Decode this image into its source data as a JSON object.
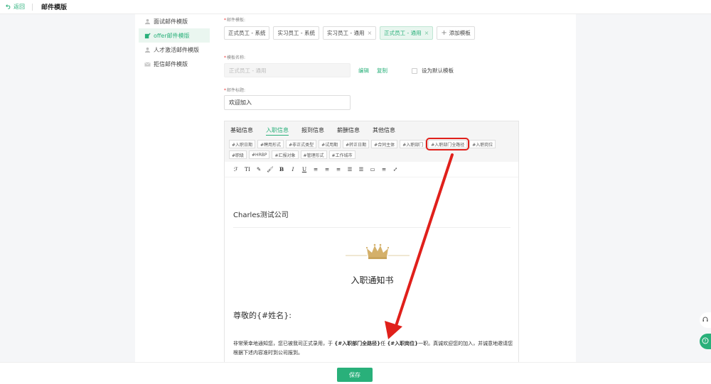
{
  "topbar": {
    "back_label": "返回",
    "title": "邮件模版"
  },
  "sidebar": {
    "items": [
      {
        "label": "面试邮件模版",
        "active": false
      },
      {
        "label": "offer邮件模版",
        "active": true
      },
      {
        "label": "人才激活邮件模版",
        "active": false
      },
      {
        "label": "拒信邮件模版",
        "active": false
      }
    ]
  },
  "form": {
    "template_label": "邮件模板:",
    "template_chips": [
      {
        "label": "正式员工 - 系统",
        "closable": false,
        "selected": false
      },
      {
        "label": "实习员工 - 系统",
        "closable": false,
        "selected": false
      },
      {
        "label": "实习员工 - 通用",
        "closable": true,
        "selected": false
      },
      {
        "label": "正式员工 - 通用",
        "closable": true,
        "selected": true
      }
    ],
    "add_template": "添加模板",
    "name_label": "模板名称:",
    "name_value": "正式员工 - 通用",
    "edit_label": "编辑",
    "copy_label": "复制",
    "default_label": "设为默认模板",
    "subject_label": "邮件标题:",
    "subject_value": "欢迎加入"
  },
  "editor": {
    "tabs": [
      "基础信息",
      "入职信息",
      "报到信息",
      "薪酬信息",
      "其他信息"
    ],
    "active_tab": 1,
    "variables": [
      "#入职日期",
      "#聘用形式",
      "#非正式类型",
      "#试用期",
      "#转正日期",
      "#合同主体",
      "#入职部门",
      "#入职部门全路径",
      "#入职岗位",
      "#职级",
      "#HRBP",
      "#汇报对象",
      "#管理形式",
      "#工作城市"
    ],
    "highlighted_variable": 7,
    "toolbar_glyphs": [
      "ℱ",
      "TI",
      "✎",
      "🖌",
      "B",
      "I",
      "U",
      "≡",
      "≡",
      "≡",
      "☰",
      "☰",
      "▭",
      "≡",
      "⤢"
    ]
  },
  "document": {
    "company": "Charles测试公司",
    "title": "入职通知书",
    "greeting": "尊敬的{#姓名}:",
    "para_1": "非常荣幸地通知您，您已被我司正式录用，于 ",
    "var_dept": "{#入职部门全路径}",
    "para_2": "任 ",
    "var_pos": "{#入职岗位}",
    "para_3": "一职。真诚欢迎您的加入，并诚意地邀请您根据下述内容准时到公司报到。"
  },
  "footer": {
    "save_label": "保存"
  },
  "colors": {
    "accent": "#29b07a",
    "annotation": "#e0201b"
  }
}
